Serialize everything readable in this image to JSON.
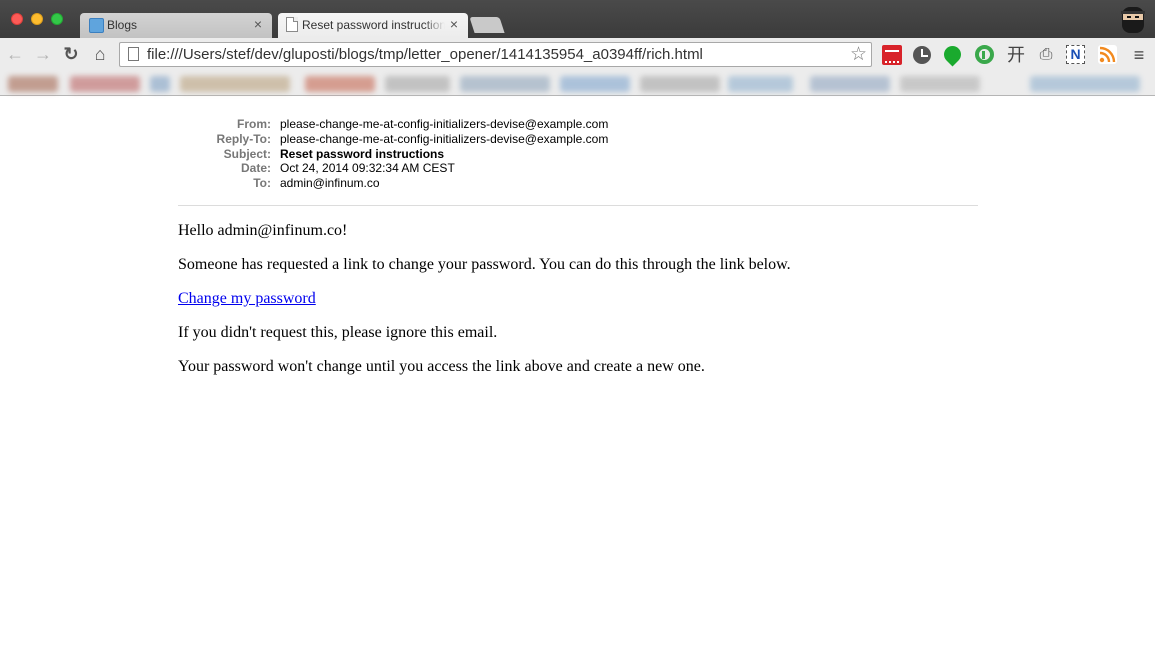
{
  "browser": {
    "tabs": [
      {
        "title": "Blogs",
        "active": false
      },
      {
        "title": "Reset password instructions",
        "active": true
      }
    ],
    "address_bar": {
      "url": "file:///Users/stef/dev/gluposti/blogs/tmp/letter_opener/1414135954_a0394ff/rich.html"
    },
    "nav_icons": {
      "back": "←",
      "forward": "→",
      "reload": "↻",
      "home": "⌂",
      "star": "☆",
      "close": "×",
      "menu": "≡",
      "tree": "开",
      "stamp": "⎙"
    },
    "extensions": [
      "red-dotted-icon",
      "clock-icon",
      "green-drop-icon",
      "green-ring-icon",
      "tree-icon",
      "stamp-icon",
      "n-icon",
      "rss-icon"
    ]
  },
  "email": {
    "headers": [
      {
        "label": "From:",
        "value": "please-change-me-at-config-initializers-devise@example.com",
        "bold": false
      },
      {
        "label": "Reply-To:",
        "value": "please-change-me-at-config-initializers-devise@example.com",
        "bold": false
      },
      {
        "label": "Subject:",
        "value": "Reset password instructions",
        "bold": true
      },
      {
        "label": "Date:",
        "value": "Oct 24, 2014 09:32:34 AM CEST",
        "bold": false
      },
      {
        "label": "To:",
        "value": "admin@infinum.co",
        "bold": false
      }
    ],
    "greeting": "Hello admin@infinum.co!",
    "paragraph_1": "Someone has requested a link to change your password. You can do this through the link below.",
    "link_text": "Change my password",
    "paragraph_2": "If you didn't request this, please ignore this email.",
    "paragraph_3": "Your password won't change until you access the link above and create a new one."
  },
  "colors": {
    "link": "#0000ee",
    "header_label": "#777777",
    "close_button": "#fc5b57",
    "minimize_button": "#fdbc2f",
    "maximize_button": "#33c748"
  }
}
